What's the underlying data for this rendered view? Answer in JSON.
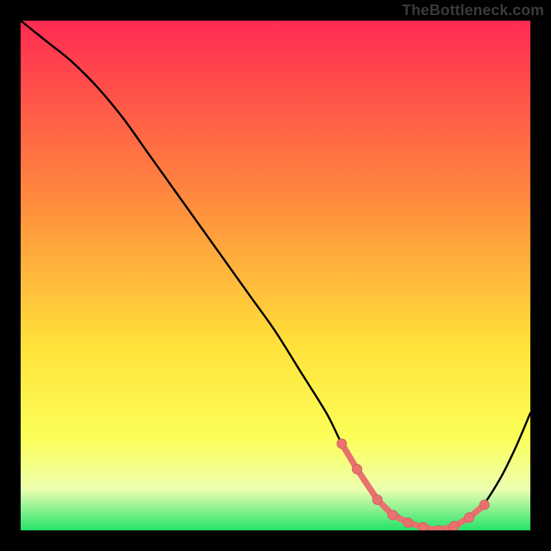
{
  "watermark": "TheBottleneck.com",
  "colors": {
    "black": "#000000",
    "curve": "#000000",
    "marker_fill": "#e9726f",
    "marker_stroke": "#cc5d5a",
    "grad_top": "#ff2b52",
    "grad_mid1": "#ff8a3d",
    "grad_mid2": "#ffe23a",
    "grad_low": "#fcff59",
    "grad_pale": "#ecffb0",
    "grad_bottom": "#23e36a"
  },
  "chart_data": {
    "type": "line",
    "title": "",
    "xlabel": "",
    "ylabel": "",
    "xlim": [
      0,
      100
    ],
    "ylim": [
      0,
      100
    ],
    "series": [
      {
        "name": "bottleneck-curve",
        "x": [
          0,
          5,
          10,
          15,
          20,
          25,
          30,
          35,
          40,
          45,
          50,
          55,
          60,
          63,
          66,
          70,
          74,
          78,
          82,
          86,
          90,
          94,
          97,
          100
        ],
        "y": [
          100,
          96,
          92,
          87,
          81,
          74,
          67,
          60,
          53,
          46,
          39,
          31,
          23,
          17,
          12,
          6,
          3,
          1,
          0,
          1,
          4,
          10,
          16,
          23
        ]
      }
    ],
    "markers": {
      "name": "highlight-points",
      "x": [
        63,
        66,
        70,
        73,
        76,
        79,
        82,
        85,
        88,
        91
      ],
      "y": [
        17,
        12,
        6,
        3,
        1.5,
        0.6,
        0,
        0.8,
        2.5,
        5
      ]
    },
    "gradient_stops": [
      {
        "offset": 0.0,
        "color": "#ff2b52"
      },
      {
        "offset": 0.35,
        "color": "#ff8a3d"
      },
      {
        "offset": 0.64,
        "color": "#ffe23a"
      },
      {
        "offset": 0.82,
        "color": "#fcff59"
      },
      {
        "offset": 0.92,
        "color": "#ecffb0"
      },
      {
        "offset": 1.0,
        "color": "#23e36a"
      }
    ]
  }
}
